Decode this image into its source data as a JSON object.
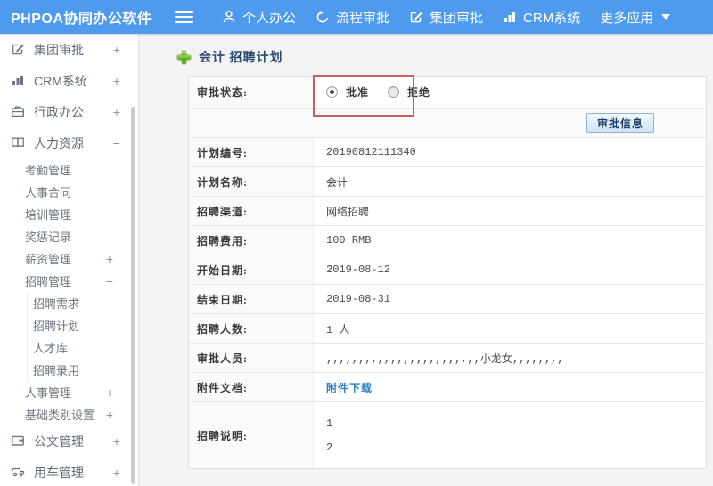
{
  "topbar": {
    "logo": "PHPOA协同办公软件",
    "nav": [
      {
        "label": "个人办公",
        "icon": "user-icon"
      },
      {
        "label": "流程审批",
        "icon": "history-icon"
      },
      {
        "label": "集团审批",
        "icon": "edit-icon"
      },
      {
        "label": "CRM系统",
        "icon": "chart-icon"
      },
      {
        "label": "更多应用",
        "icon": "caret-down-icon"
      }
    ]
  },
  "sidebar": {
    "items": [
      {
        "label": "集团审批",
        "toggle": "+"
      },
      {
        "label": "CRM系统",
        "toggle": "+"
      },
      {
        "label": "行政办公",
        "toggle": "+"
      },
      {
        "label": "人力资源",
        "toggle": "−"
      },
      {
        "label": "考勤管理"
      },
      {
        "label": "人事合同"
      },
      {
        "label": "培训管理"
      },
      {
        "label": "奖惩记录"
      },
      {
        "label": "薪资管理",
        "toggle": "+"
      },
      {
        "label": "招聘管理",
        "toggle": "−"
      },
      {
        "label": "招聘需求"
      },
      {
        "label": "招聘计划"
      },
      {
        "label": "人才库"
      },
      {
        "label": "招聘录用"
      },
      {
        "label": "人事管理",
        "toggle": "+"
      },
      {
        "label": "基础类别设置",
        "toggle": "+"
      },
      {
        "label": "公文管理",
        "toggle": "+"
      },
      {
        "label": "用车管理",
        "toggle": "+"
      }
    ]
  },
  "main": {
    "title": "会计 招聘计划",
    "approval_status": {
      "label": "审批状态:",
      "options": [
        {
          "label": "批准",
          "selected": true
        },
        {
          "label": "拒绝",
          "selected": false
        }
      ]
    },
    "approve_button": "审批信息",
    "fields": [
      {
        "label": "计划编号:",
        "value": "20190812111340"
      },
      {
        "label": "计划名称:",
        "value": "会计"
      },
      {
        "label": "招聘渠道:",
        "value": "网络招聘"
      },
      {
        "label": "招聘费用:",
        "value": "100 RMB"
      },
      {
        "label": "开始日期:",
        "value": "2019-08-12"
      },
      {
        "label": "结束日期:",
        "value": "2019-08-31"
      },
      {
        "label": "招聘人数:",
        "value": "1 人"
      },
      {
        "label": "审批人员:",
        "value": ",,,,,,,,,,,,,,,,,,,,,,,,小龙女,,,,,,,,"
      }
    ],
    "attachment": {
      "label": "附件文档:",
      "link": "附件下载"
    },
    "description": {
      "label": "招聘说明:",
      "lines": [
        "1",
        "2"
      ]
    },
    "colors": {
      "topbar": "#4e9bee",
      "highlight_box": "#c4605f",
      "link": "#2e7cc3"
    }
  }
}
